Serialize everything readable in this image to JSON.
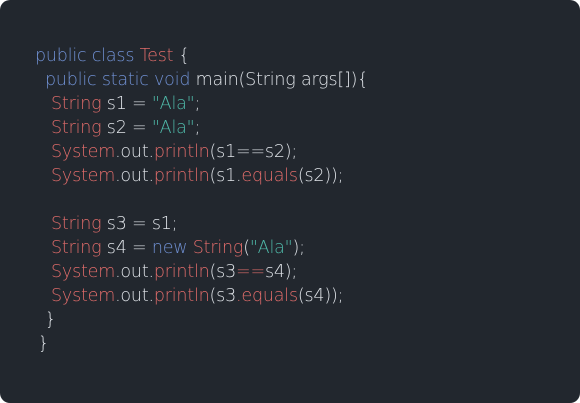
{
  "lines": [
    {
      "indent": 35,
      "tokens": [
        {
          "t": "public class ",
          "c": "kw"
        },
        {
          "t": "Test",
          "c": "type"
        },
        {
          "t": " {",
          "c": "plain"
        }
      ]
    },
    {
      "indent": 45,
      "tokens": [
        {
          "t": "public static void ",
          "c": "kw"
        },
        {
          "t": "main(String args[]){",
          "c": "plain"
        }
      ]
    },
    {
      "indent": 51,
      "tokens": [
        {
          "t": "String",
          "c": "type"
        },
        {
          "t": " s1 = ",
          "c": "plain"
        },
        {
          "t": "\"Ala\"",
          "c": "str"
        },
        {
          "t": ";",
          "c": "plain"
        }
      ]
    },
    {
      "indent": 51,
      "tokens": [
        {
          "t": "String",
          "c": "type"
        },
        {
          "t": " s2 = ",
          "c": "plain"
        },
        {
          "t": "\"Ala\"",
          "c": "str"
        },
        {
          "t": ";",
          "c": "plain"
        }
      ]
    },
    {
      "indent": 51,
      "tokens": [
        {
          "t": "System",
          "c": "type"
        },
        {
          "t": ".out.",
          "c": "plain"
        },
        {
          "t": "println",
          "c": "type"
        },
        {
          "t": "(s1==s2);",
          "c": "plain"
        }
      ]
    },
    {
      "indent": 51,
      "tokens": [
        {
          "t": "System",
          "c": "type"
        },
        {
          "t": ".out.",
          "c": "plain"
        },
        {
          "t": "println",
          "c": "type"
        },
        {
          "t": "(s1.",
          "c": "plain"
        },
        {
          "t": "equals",
          "c": "type"
        },
        {
          "t": "(s2));",
          "c": "plain"
        }
      ]
    },
    {
      "indent": 51,
      "tokens": []
    },
    {
      "indent": 51,
      "tokens": [
        {
          "t": "String",
          "c": "type"
        },
        {
          "t": " s3 = s1;",
          "c": "plain"
        }
      ]
    },
    {
      "indent": 51,
      "tokens": [
        {
          "t": "String",
          "c": "type"
        },
        {
          "t": " s4 = ",
          "c": "plain"
        },
        {
          "t": "new ",
          "c": "kw"
        },
        {
          "t": "String",
          "c": "type"
        },
        {
          "t": "(",
          "c": "plain"
        },
        {
          "t": "\"Ala\"",
          "c": "str"
        },
        {
          "t": ");",
          "c": "plain"
        }
      ]
    },
    {
      "indent": 51,
      "tokens": [
        {
          "t": "System",
          "c": "type"
        },
        {
          "t": ".out.",
          "c": "plain"
        },
        {
          "t": "println",
          "c": "type"
        },
        {
          "t": "(s3",
          "c": "plain"
        },
        {
          "t": "==",
          "c": "op"
        },
        {
          "t": "s4);",
          "c": "plain"
        }
      ]
    },
    {
      "indent": 51,
      "tokens": [
        {
          "t": "System",
          "c": "type"
        },
        {
          "t": ".out.",
          "c": "plain"
        },
        {
          "t": "println",
          "c": "type"
        },
        {
          "t": "(s3",
          "c": "plain"
        },
        {
          "t": ".",
          "c": "op"
        },
        {
          "t": "equals",
          "c": "type"
        },
        {
          "t": "(s4));",
          "c": "plain"
        }
      ]
    },
    {
      "indent": 45,
      "tokens": [
        {
          "t": "}",
          "c": "plain"
        }
      ]
    },
    {
      "indent": 38,
      "tokens": [
        {
          "t": "}",
          "c": "plain"
        }
      ]
    }
  ]
}
